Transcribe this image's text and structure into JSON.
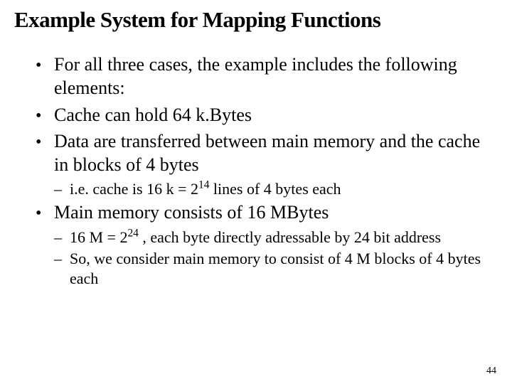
{
  "title": "Example System for Mapping Functions",
  "bullets": {
    "b0": "For all three cases, the example includes the following elements:",
    "b1_pre": "Cache can hold ",
    "b1_em": "64 k.Bytes",
    "b2_pre": "Data are transferred between main memory and the cache in ",
    "b2_em": "blocks of 4 bytes",
    "b2s_pre": "i.e. cache is ",
    "b2s_mid1": "16 k = 2",
    "b2s_sup": "14",
    "b2s_mid2": " lines",
    "b2s_post": " of 4 bytes each",
    "b3_pre": "Main memory consists of ",
    "b3_em": "16 MBytes",
    "b3s1_pre": "16 M = 2",
    "b3s1_sup": "24",
    "b3s1_mid": " , each byte directly adressable by ",
    "b3s1_em": "24 bit address",
    "b3s2_pre": "So, we consider main memory to consist of ",
    "b3s2_em": "4 M blocks",
    "b3s2_post": " of 4 bytes each"
  },
  "pageNumber": "44"
}
